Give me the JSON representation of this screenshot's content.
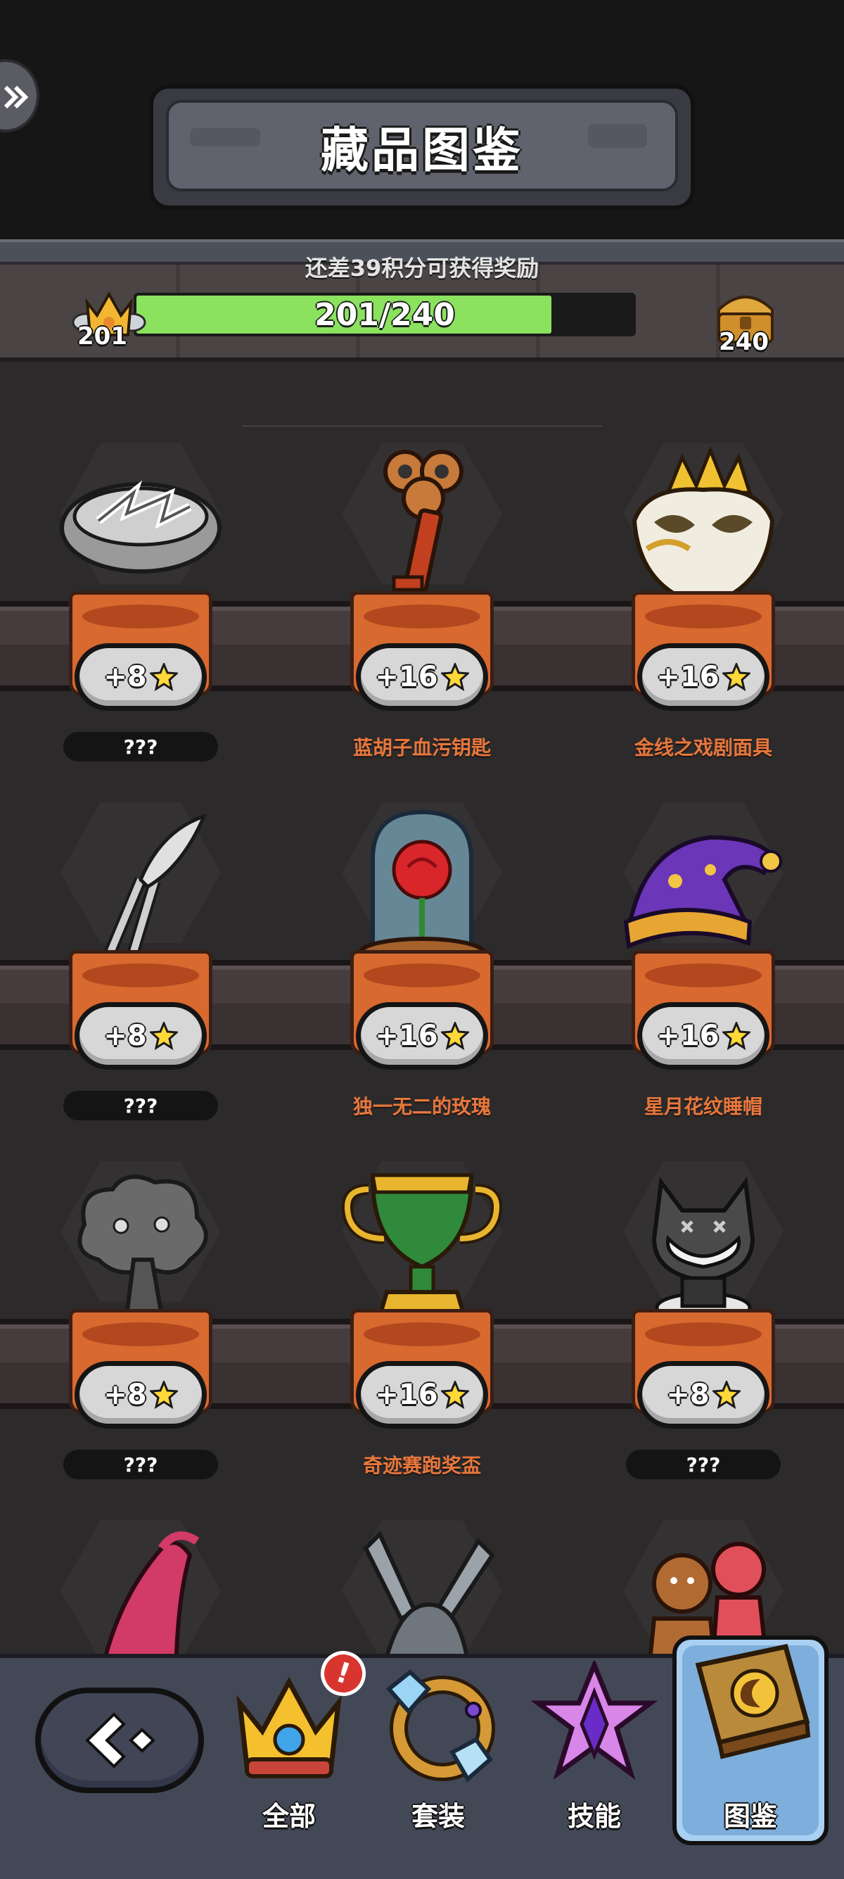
{
  "header": {
    "title": "藏品图鉴"
  },
  "progress": {
    "hint": "还差39积分可获得奖励",
    "current_level": "201",
    "target_level": "240",
    "label": "201/240",
    "fraction": 0.8375,
    "fill_color": "#8ae25e"
  },
  "items": [
    {
      "score": "+8",
      "name": "???",
      "discovered": false,
      "icon": "bracelet-icon"
    },
    {
      "score": "+16",
      "name": "蓝胡子血污钥匙",
      "discovered": true,
      "icon": "key-icon"
    },
    {
      "score": "+16",
      "name": "金线之戏剧面具",
      "discovered": true,
      "icon": "mask-icon"
    },
    {
      "score": "+8",
      "name": "???",
      "discovered": false,
      "icon": "wheat-icon"
    },
    {
      "score": "+16",
      "name": "独一无二的玫瑰",
      "discovered": true,
      "icon": "rose-icon"
    },
    {
      "score": "+16",
      "name": "星月花纹睡帽",
      "discovered": true,
      "icon": "nightcap-icon"
    },
    {
      "score": "+8",
      "name": "???",
      "discovered": false,
      "icon": "tree-icon"
    },
    {
      "score": "+16",
      "name": "奇迹赛跑奖盃",
      "discovered": true,
      "icon": "trophy-icon"
    },
    {
      "score": "+8",
      "name": "???",
      "discovered": false,
      "icon": "wolf-icon"
    },
    {
      "icon": "high-heel-icon"
    },
    {
      "icon": "scissors-icon"
    },
    {
      "icon": "gingerbread-icon"
    }
  ],
  "nav": {
    "tabs": [
      {
        "label": "全部",
        "icon": "crown-icon",
        "alert": "!"
      },
      {
        "label": "套装",
        "icon": "ring-icon"
      },
      {
        "label": "技能",
        "icon": "star-gem-icon"
      },
      {
        "label": "图鉴",
        "icon": "book-icon",
        "active": true
      }
    ]
  },
  "colors": {
    "accent_name": "#e7773c",
    "pedestal": "#d8692f",
    "active_tab": "#a9d0f2"
  }
}
